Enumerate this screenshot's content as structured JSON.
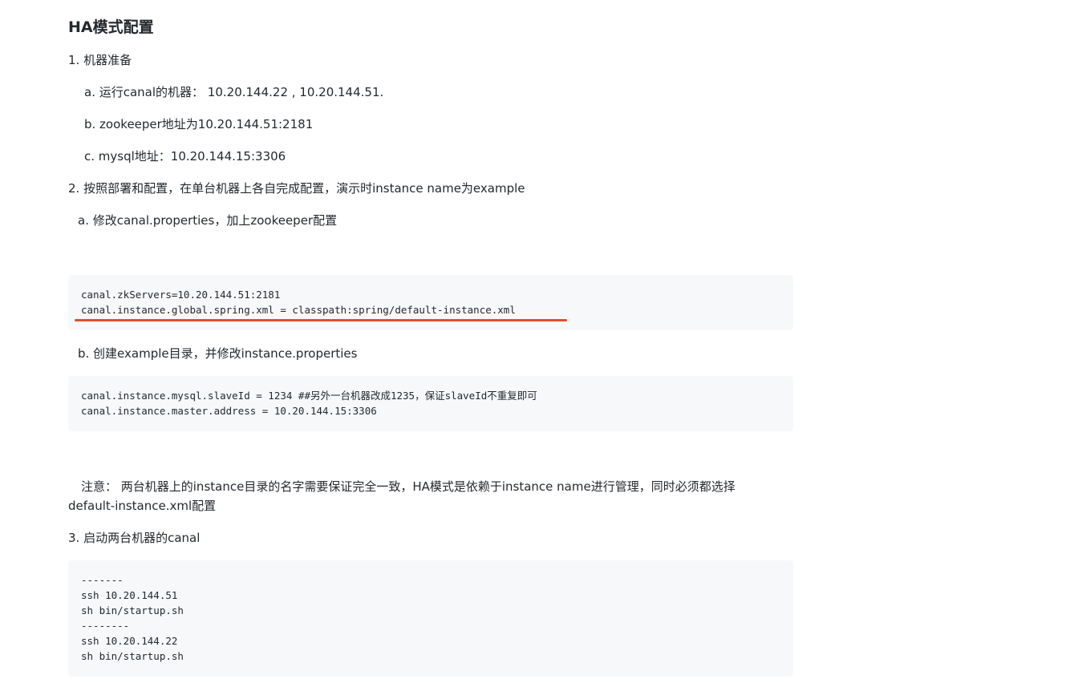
{
  "heading": "HA模式配置",
  "steps": {
    "s1": "1.  机器准备",
    "s1a": "a.  运行canal的机器：  10.20.144.22 , 10.20.144.51.",
    "s1b": "b.  zookeeper地址为10.20.144.51:2181",
    "s1c": "c.  mysql地址：10.20.144.15:3306",
    "s2": "2.  按照部署和配置，在单台机器上各自完成配置，演示时instance name为example",
    "s2a": "a. 修改canal.properties，加上zookeeper配置",
    "s2b": "b. 创建example目录，并修改instance.properties",
    "note_line1": "注意：  两台机器上的instance目录的名字需要保证完全一致，HA模式是依赖于instance name进行管理，同时必须都选择",
    "note_line2": "default-instance.xml配置",
    "s3": "3.  启动两台机器的canal"
  },
  "code_blocks": {
    "canal_properties": [
      "canal.zkServers=10.20.144.51:2181",
      "canal.instance.global.spring.xml = classpath:spring/default-instance.xml"
    ],
    "instance_properties": [
      "canal.instance.mysql.slaveId = 1234 ##另外一台机器改成1235，保证slaveId不重复即可",
      "canal.instance.master.address = 10.20.144.15:3306"
    ],
    "startup": [
      "-------",
      "ssh 10.20.144.51",
      "sh bin/startup.sh",
      "--------",
      "ssh 10.20.144.22",
      "sh bin/startup.sh"
    ]
  },
  "colors": {
    "code_background": "#f6f8fa",
    "highlight_underline": "#e0502f",
    "text": "#24292e"
  }
}
